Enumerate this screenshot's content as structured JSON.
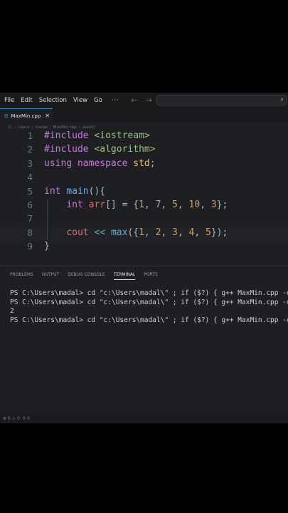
{
  "menu": {
    "items": [
      "File",
      "Edit",
      "Selection",
      "View",
      "Go"
    ],
    "more": "···"
  },
  "nav": {
    "arrows": "← →"
  },
  "tab": {
    "label": "MaxMin.cpp",
    "icon": "G",
    "close": "✕"
  },
  "breadcrumb": [
    "C:",
    "Users",
    "madal",
    "MaxMin.cpp",
    "main()"
  ],
  "editor": {
    "lines": [
      {
        "n": "1",
        "tokens": [
          [
            "pp",
            "#include"
          ],
          [
            "plain",
            " "
          ],
          [
            "inc",
            "<iostream>"
          ]
        ]
      },
      {
        "n": "2",
        "tokens": [
          [
            "pp",
            "#include"
          ],
          [
            "plain",
            " "
          ],
          [
            "inc",
            "<algorithm>"
          ]
        ]
      },
      {
        "n": "3",
        "tokens": [
          [
            "kw",
            "using"
          ],
          [
            "plain",
            " "
          ],
          [
            "kw",
            "namespace"
          ],
          [
            "plain",
            " "
          ],
          [
            "ns",
            "std"
          ],
          [
            "plain",
            ";"
          ]
        ]
      },
      {
        "n": "4",
        "tokens": []
      },
      {
        "n": "5",
        "tokens": [
          [
            "type",
            "int"
          ],
          [
            "plain",
            " "
          ],
          [
            "fn",
            "main"
          ],
          [
            "plain",
            "(){"
          ]
        ]
      },
      {
        "n": "6",
        "tokens": [
          [
            "plain",
            "    "
          ],
          [
            "type",
            "int"
          ],
          [
            "plain",
            " "
          ],
          [
            "var",
            "arr"
          ],
          [
            "plain",
            "[] = {"
          ],
          [
            "num",
            "1"
          ],
          [
            "plain",
            ", "
          ],
          [
            "num",
            "7"
          ],
          [
            "plain",
            ", "
          ],
          [
            "num",
            "5"
          ],
          [
            "plain",
            ", "
          ],
          [
            "num",
            "10"
          ],
          [
            "plain",
            ", "
          ],
          [
            "num",
            "3"
          ],
          [
            "plain",
            "};"
          ]
        ]
      },
      {
        "n": "7",
        "tokens": []
      },
      {
        "n": "8",
        "tokens": [
          [
            "plain",
            "    "
          ],
          [
            "var",
            "cout"
          ],
          [
            "plain",
            " "
          ],
          [
            "op",
            "<<"
          ],
          [
            "plain",
            " "
          ],
          [
            "fn",
            "max"
          ],
          [
            "plain",
            "({"
          ],
          [
            "num",
            "1"
          ],
          [
            "plain",
            ", "
          ],
          [
            "num",
            "2"
          ],
          [
            "plain",
            ", "
          ],
          [
            "num",
            "3"
          ],
          [
            "plain",
            ", "
          ],
          [
            "num",
            "4"
          ],
          [
            "plain",
            ", "
          ],
          [
            "num",
            "5"
          ],
          [
            "plain",
            "});"
          ]
        ]
      },
      {
        "n": "9",
        "tokens": [
          [
            "plain",
            "}"
          ]
        ]
      }
    ]
  },
  "panel": {
    "tabs": [
      "PROBLEMS",
      "OUTPUT",
      "DEBUG CONSOLE",
      "TERMINAL",
      "PORTS"
    ],
    "active_tab": "TERMINAL"
  },
  "terminal": {
    "lines": [
      "PS C:\\Users\\madal> cd \"c:\\Users\\madal\\\" ; if ($?) { g++ MaxMin.cpp -o",
      "PS C:\\Users\\madal> cd \"c:\\Users\\madal\\\" ; if ($?) { g++ MaxMin.cpp -o",
      "2",
      "PS C:\\Users\\madal> cd \"c:\\Users\\madal\\\" ; if ($?) { g++ MaxMin.cpp -o"
    ]
  },
  "status": {
    "errors": "⊗ 0 ⚠ 0",
    "ports": "⚲ 0"
  }
}
